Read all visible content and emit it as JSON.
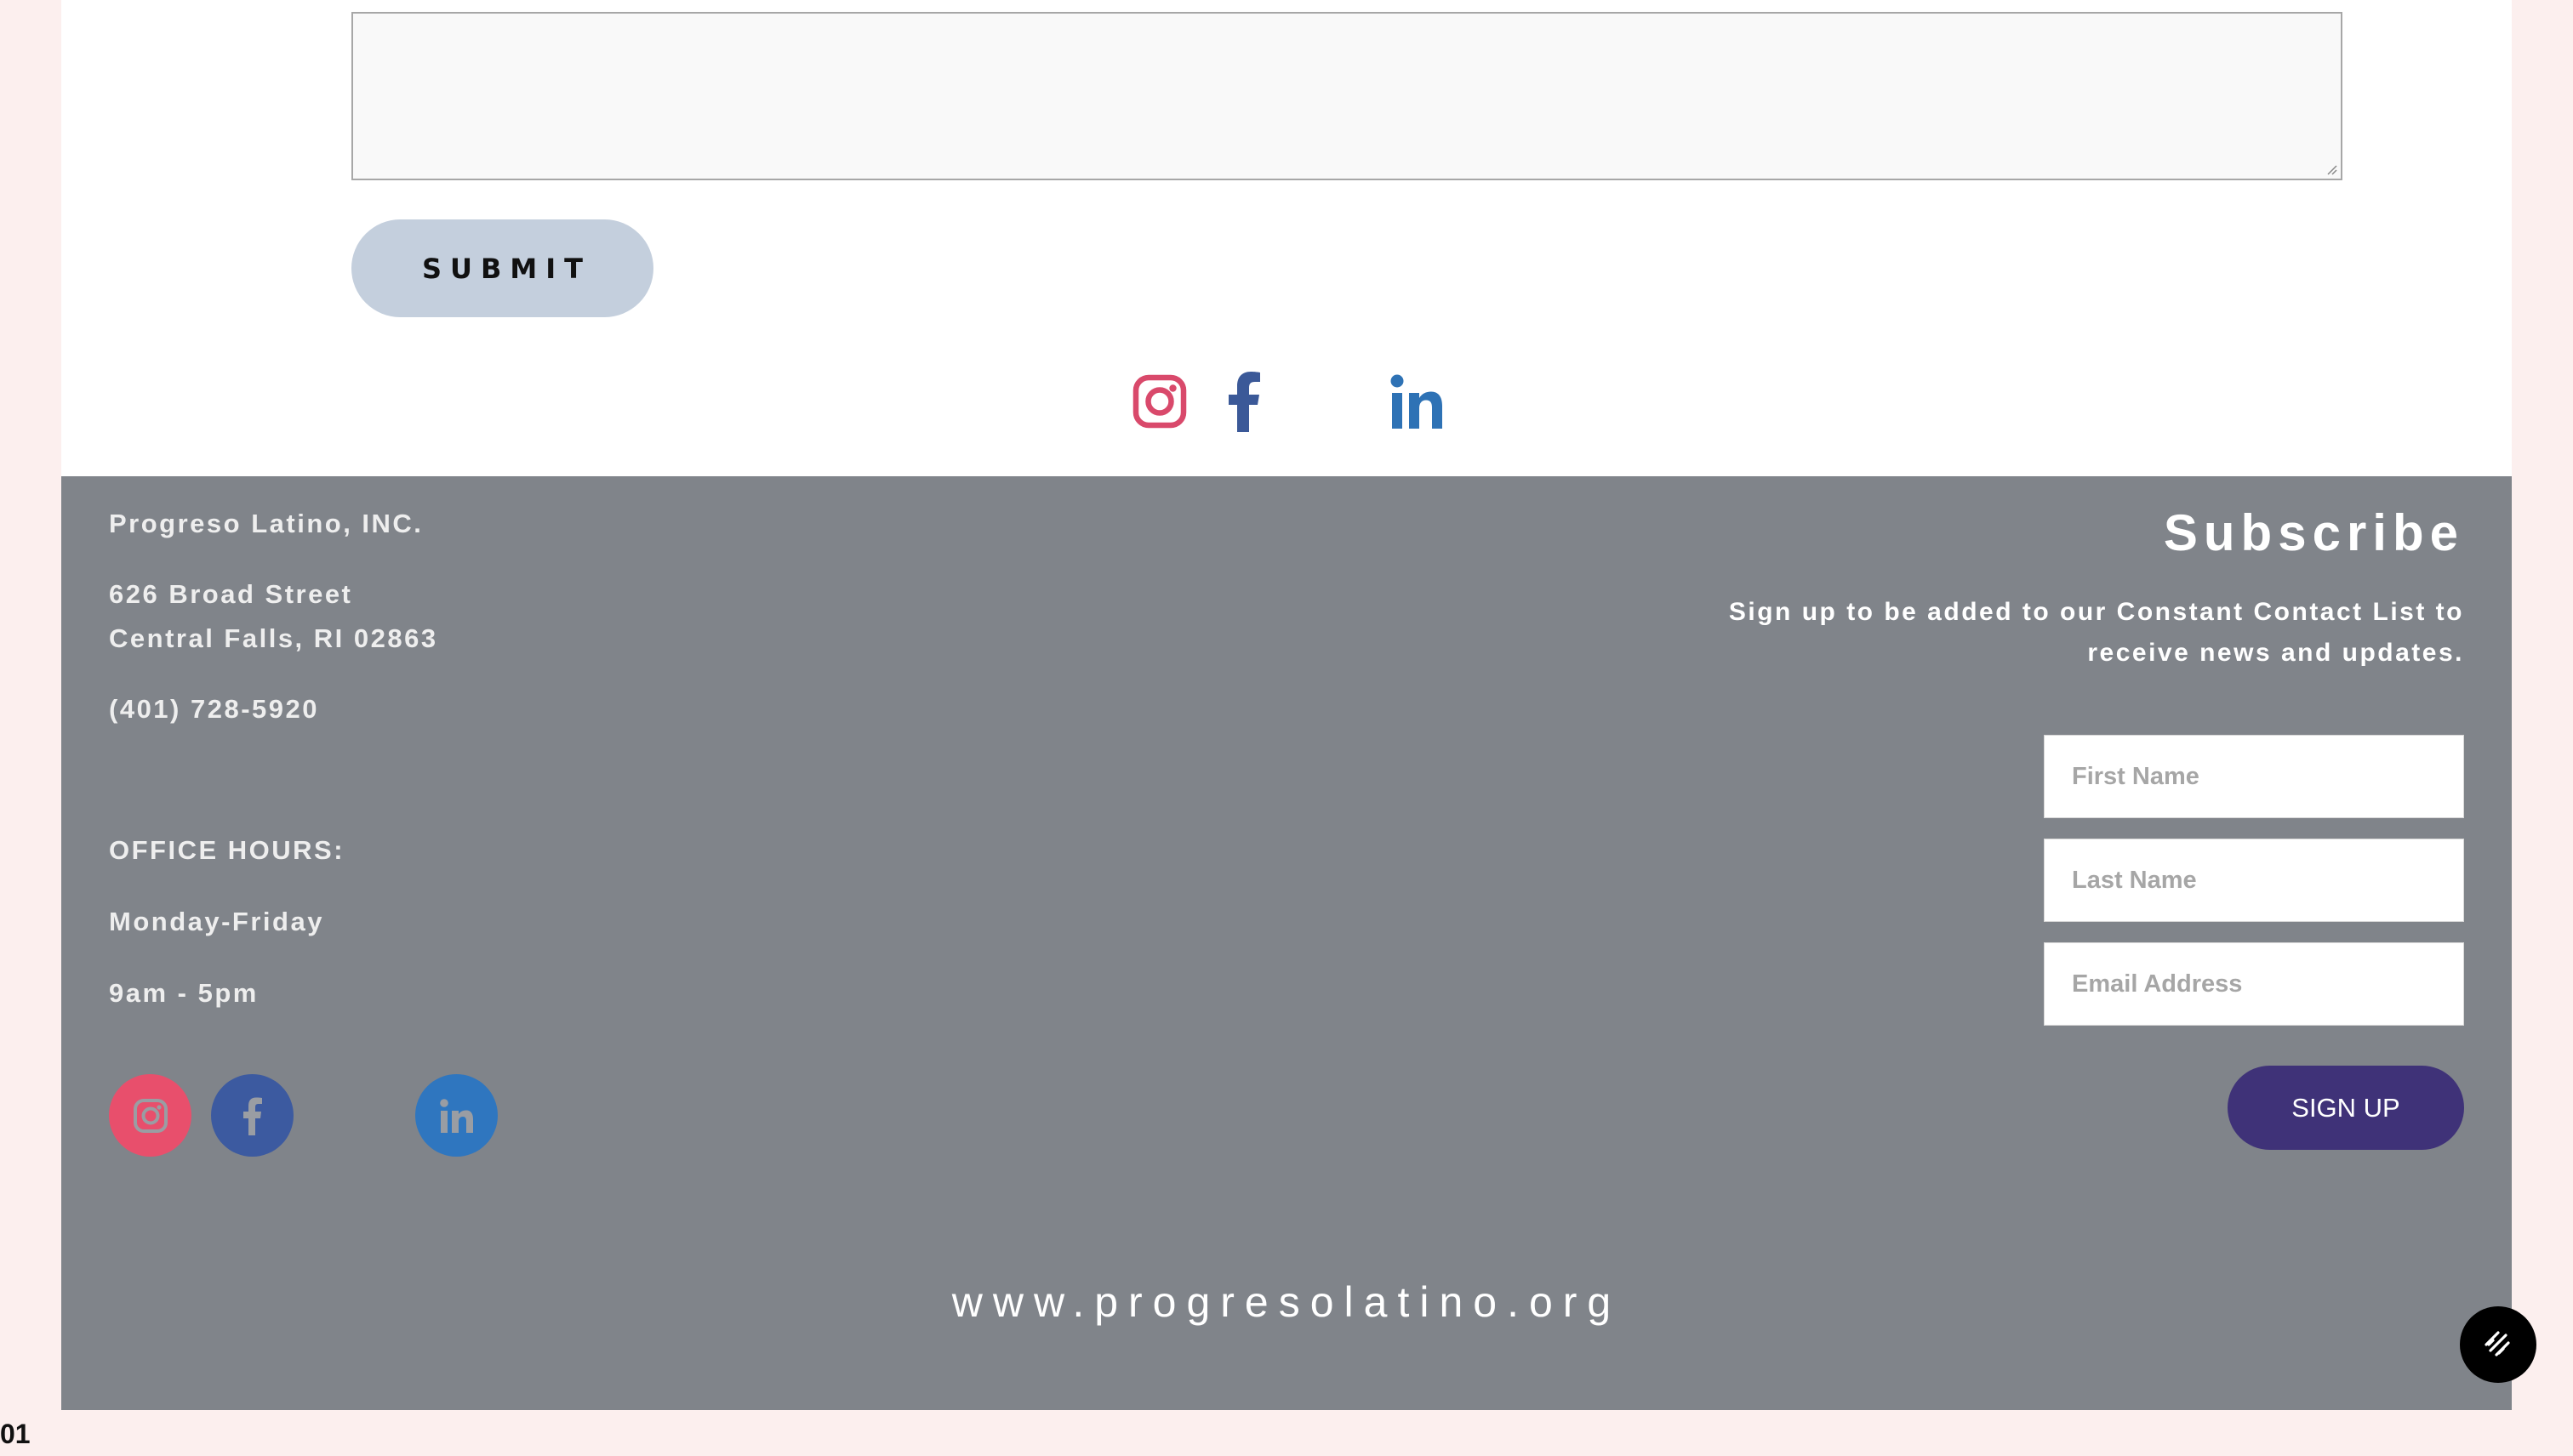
{
  "form": {
    "message_value": "",
    "submit_label": "SUBMIT"
  },
  "social_top": {
    "icons": [
      "instagram-icon",
      "facebook-icon",
      "linkedin-icon"
    ],
    "colors": {
      "instagram": "#d9496b",
      "facebook": "#3b5998",
      "linkedin": "#2e72b5"
    }
  },
  "footer": {
    "org_name": "Progreso Latino, INC.",
    "address_line1": "626 Broad Street",
    "address_line2": "Central Falls, RI 02863",
    "phone": "(401) 728-5920",
    "hours_heading": "OFFICE HOURS:",
    "hours_days": "Monday-Friday",
    "hours_time": "9am - 5pm",
    "social_icons": [
      "instagram-icon",
      "facebook-icon",
      "linkedin-icon"
    ],
    "colors": {
      "background": "#80848a",
      "instagram": "#e84f6c",
      "facebook": "#3c5aa0",
      "linkedin": "#2f76bf"
    }
  },
  "subscribe": {
    "title": "Subscribe",
    "description": "Sign up to be added to our Constant Contact List to receive news and updates.",
    "first_name_placeholder": "First Name",
    "last_name_placeholder": "Last Name",
    "email_placeholder": "Email Address",
    "signup_label": "SIGN UP",
    "button_color": "#3f3278"
  },
  "website": "www.progresolatino.org",
  "corner_label": "01",
  "fab_icon": "squarespace-logo-icon"
}
